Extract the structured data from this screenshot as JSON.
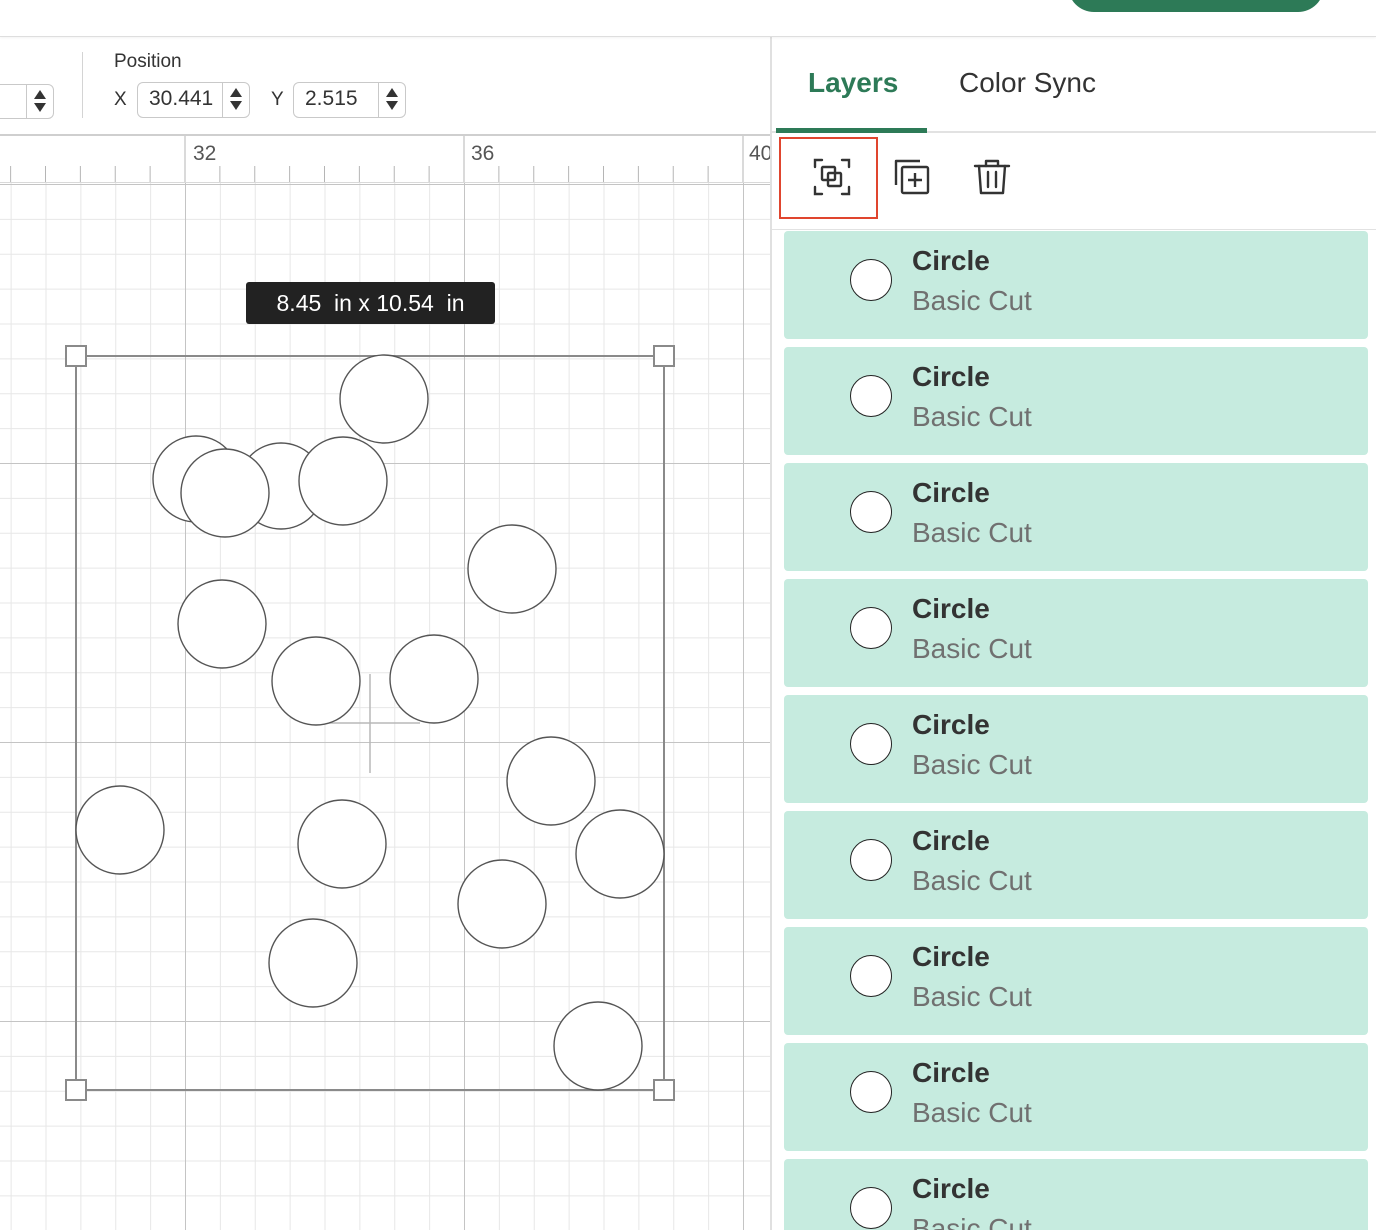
{
  "toolbar": {
    "partial_field_value": "",
    "position_label": "Position",
    "x_label": "X",
    "x_value": "30.441",
    "y_label": "Y",
    "y_value": "2.515"
  },
  "ruler": {
    "marks": [
      "32",
      "36",
      "40"
    ]
  },
  "canvas": {
    "size_tooltip": "8.45  in x 10.54  in",
    "shape_count": 17
  },
  "panel": {
    "tabs": [
      {
        "label": "Layers",
        "active": true
      },
      {
        "label": "Color Sync",
        "active": false
      }
    ],
    "tools": [
      {
        "icon": "group-select-icon",
        "highlighted": true
      },
      {
        "icon": "duplicate-icon",
        "highlighted": false
      },
      {
        "icon": "trash-icon",
        "highlighted": false
      }
    ],
    "layers": [
      {
        "name": "Circle",
        "type": "Basic Cut"
      },
      {
        "name": "Circle",
        "type": "Basic Cut"
      },
      {
        "name": "Circle",
        "type": "Basic Cut"
      },
      {
        "name": "Circle",
        "type": "Basic Cut"
      },
      {
        "name": "Circle",
        "type": "Basic Cut"
      },
      {
        "name": "Circle",
        "type": "Basic Cut"
      },
      {
        "name": "Circle",
        "type": "Basic Cut"
      },
      {
        "name": "Circle",
        "type": "Basic Cut"
      },
      {
        "name": "Circle",
        "type": "Basic Cut"
      }
    ]
  },
  "colors": {
    "accent": "#2d7a57",
    "layer_bg": "#c6ebdf",
    "highlight": "#e0452e"
  }
}
